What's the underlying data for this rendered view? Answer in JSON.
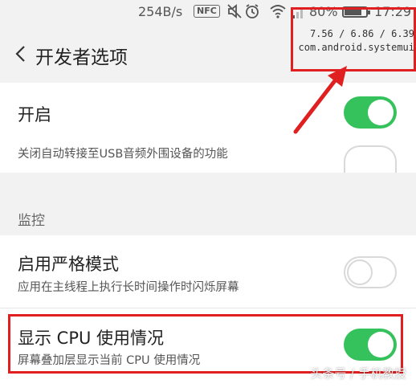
{
  "status_bar": {
    "net_speed": "254B/s",
    "nfc": "NFC",
    "battery_percent": "80%",
    "battery_level": 0.8,
    "time": "17:29",
    "icons": [
      "nfc-icon",
      "mute-icon",
      "alarm-icon",
      "wifi-icon",
      "signal-icon",
      "battery-icon"
    ]
  },
  "header": {
    "title": "开发者选项"
  },
  "overlay": {
    "load": "7.56 / 6.86 / 6.39",
    "process": "com.android.systemui"
  },
  "items": {
    "enable": {
      "label": "开启",
      "state": "on"
    },
    "usb_audio": {
      "subtitle": "关闭自动转接至USB音频外围设备的功能",
      "state": "off"
    },
    "strict_mode": {
      "label": "启用严格模式",
      "subtitle": "应用在主线程上执行长时间操作时闪烁屏幕",
      "state": "off"
    },
    "show_cpu": {
      "label": "显示 CPU 使用情况",
      "subtitle": "屏幕叠加层显示当前 CPU 使用情况",
      "state": "on"
    }
  },
  "section": {
    "monitoring": "监控"
  },
  "watermark": "头条号 / 手机教授",
  "colors": {
    "toggle_on": "#35c25c",
    "highlight": "#e02020",
    "background": "#f2f2f2"
  }
}
